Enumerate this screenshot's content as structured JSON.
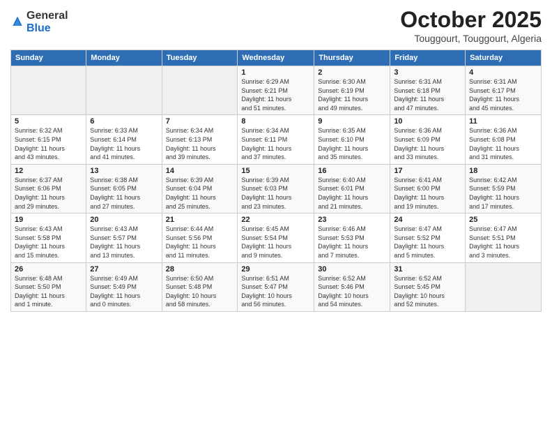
{
  "header": {
    "logo_general": "General",
    "logo_blue": "Blue",
    "month_title": "October 2025",
    "location": "Touggourt, Touggourt, Algeria"
  },
  "weekdays": [
    "Sunday",
    "Monday",
    "Tuesday",
    "Wednesday",
    "Thursday",
    "Friday",
    "Saturday"
  ],
  "weeks": [
    [
      {
        "day": "",
        "info": ""
      },
      {
        "day": "",
        "info": ""
      },
      {
        "day": "",
        "info": ""
      },
      {
        "day": "1",
        "info": "Sunrise: 6:29 AM\nSunset: 6:21 PM\nDaylight: 11 hours\nand 51 minutes."
      },
      {
        "day": "2",
        "info": "Sunrise: 6:30 AM\nSunset: 6:19 PM\nDaylight: 11 hours\nand 49 minutes."
      },
      {
        "day": "3",
        "info": "Sunrise: 6:31 AM\nSunset: 6:18 PM\nDaylight: 11 hours\nand 47 minutes."
      },
      {
        "day": "4",
        "info": "Sunrise: 6:31 AM\nSunset: 6:17 PM\nDaylight: 11 hours\nand 45 minutes."
      }
    ],
    [
      {
        "day": "5",
        "info": "Sunrise: 6:32 AM\nSunset: 6:15 PM\nDaylight: 11 hours\nand 43 minutes."
      },
      {
        "day": "6",
        "info": "Sunrise: 6:33 AM\nSunset: 6:14 PM\nDaylight: 11 hours\nand 41 minutes."
      },
      {
        "day": "7",
        "info": "Sunrise: 6:34 AM\nSunset: 6:13 PM\nDaylight: 11 hours\nand 39 minutes."
      },
      {
        "day": "8",
        "info": "Sunrise: 6:34 AM\nSunset: 6:11 PM\nDaylight: 11 hours\nand 37 minutes."
      },
      {
        "day": "9",
        "info": "Sunrise: 6:35 AM\nSunset: 6:10 PM\nDaylight: 11 hours\nand 35 minutes."
      },
      {
        "day": "10",
        "info": "Sunrise: 6:36 AM\nSunset: 6:09 PM\nDaylight: 11 hours\nand 33 minutes."
      },
      {
        "day": "11",
        "info": "Sunrise: 6:36 AM\nSunset: 6:08 PM\nDaylight: 11 hours\nand 31 minutes."
      }
    ],
    [
      {
        "day": "12",
        "info": "Sunrise: 6:37 AM\nSunset: 6:06 PM\nDaylight: 11 hours\nand 29 minutes."
      },
      {
        "day": "13",
        "info": "Sunrise: 6:38 AM\nSunset: 6:05 PM\nDaylight: 11 hours\nand 27 minutes."
      },
      {
        "day": "14",
        "info": "Sunrise: 6:39 AM\nSunset: 6:04 PM\nDaylight: 11 hours\nand 25 minutes."
      },
      {
        "day": "15",
        "info": "Sunrise: 6:39 AM\nSunset: 6:03 PM\nDaylight: 11 hours\nand 23 minutes."
      },
      {
        "day": "16",
        "info": "Sunrise: 6:40 AM\nSunset: 6:01 PM\nDaylight: 11 hours\nand 21 minutes."
      },
      {
        "day": "17",
        "info": "Sunrise: 6:41 AM\nSunset: 6:00 PM\nDaylight: 11 hours\nand 19 minutes."
      },
      {
        "day": "18",
        "info": "Sunrise: 6:42 AM\nSunset: 5:59 PM\nDaylight: 11 hours\nand 17 minutes."
      }
    ],
    [
      {
        "day": "19",
        "info": "Sunrise: 6:43 AM\nSunset: 5:58 PM\nDaylight: 11 hours\nand 15 minutes."
      },
      {
        "day": "20",
        "info": "Sunrise: 6:43 AM\nSunset: 5:57 PM\nDaylight: 11 hours\nand 13 minutes."
      },
      {
        "day": "21",
        "info": "Sunrise: 6:44 AM\nSunset: 5:56 PM\nDaylight: 11 hours\nand 11 minutes."
      },
      {
        "day": "22",
        "info": "Sunrise: 6:45 AM\nSunset: 5:54 PM\nDaylight: 11 hours\nand 9 minutes."
      },
      {
        "day": "23",
        "info": "Sunrise: 6:46 AM\nSunset: 5:53 PM\nDaylight: 11 hours\nand 7 minutes."
      },
      {
        "day": "24",
        "info": "Sunrise: 6:47 AM\nSunset: 5:52 PM\nDaylight: 11 hours\nand 5 minutes."
      },
      {
        "day": "25",
        "info": "Sunrise: 6:47 AM\nSunset: 5:51 PM\nDaylight: 11 hours\nand 3 minutes."
      }
    ],
    [
      {
        "day": "26",
        "info": "Sunrise: 6:48 AM\nSunset: 5:50 PM\nDaylight: 11 hours\nand 1 minute."
      },
      {
        "day": "27",
        "info": "Sunrise: 6:49 AM\nSunset: 5:49 PM\nDaylight: 11 hours\nand 0 minutes."
      },
      {
        "day": "28",
        "info": "Sunrise: 6:50 AM\nSunset: 5:48 PM\nDaylight: 10 hours\nand 58 minutes."
      },
      {
        "day": "29",
        "info": "Sunrise: 6:51 AM\nSunset: 5:47 PM\nDaylight: 10 hours\nand 56 minutes."
      },
      {
        "day": "30",
        "info": "Sunrise: 6:52 AM\nSunset: 5:46 PM\nDaylight: 10 hours\nand 54 minutes."
      },
      {
        "day": "31",
        "info": "Sunrise: 6:52 AM\nSunset: 5:45 PM\nDaylight: 10 hours\nand 52 minutes."
      },
      {
        "day": "",
        "info": ""
      }
    ]
  ]
}
